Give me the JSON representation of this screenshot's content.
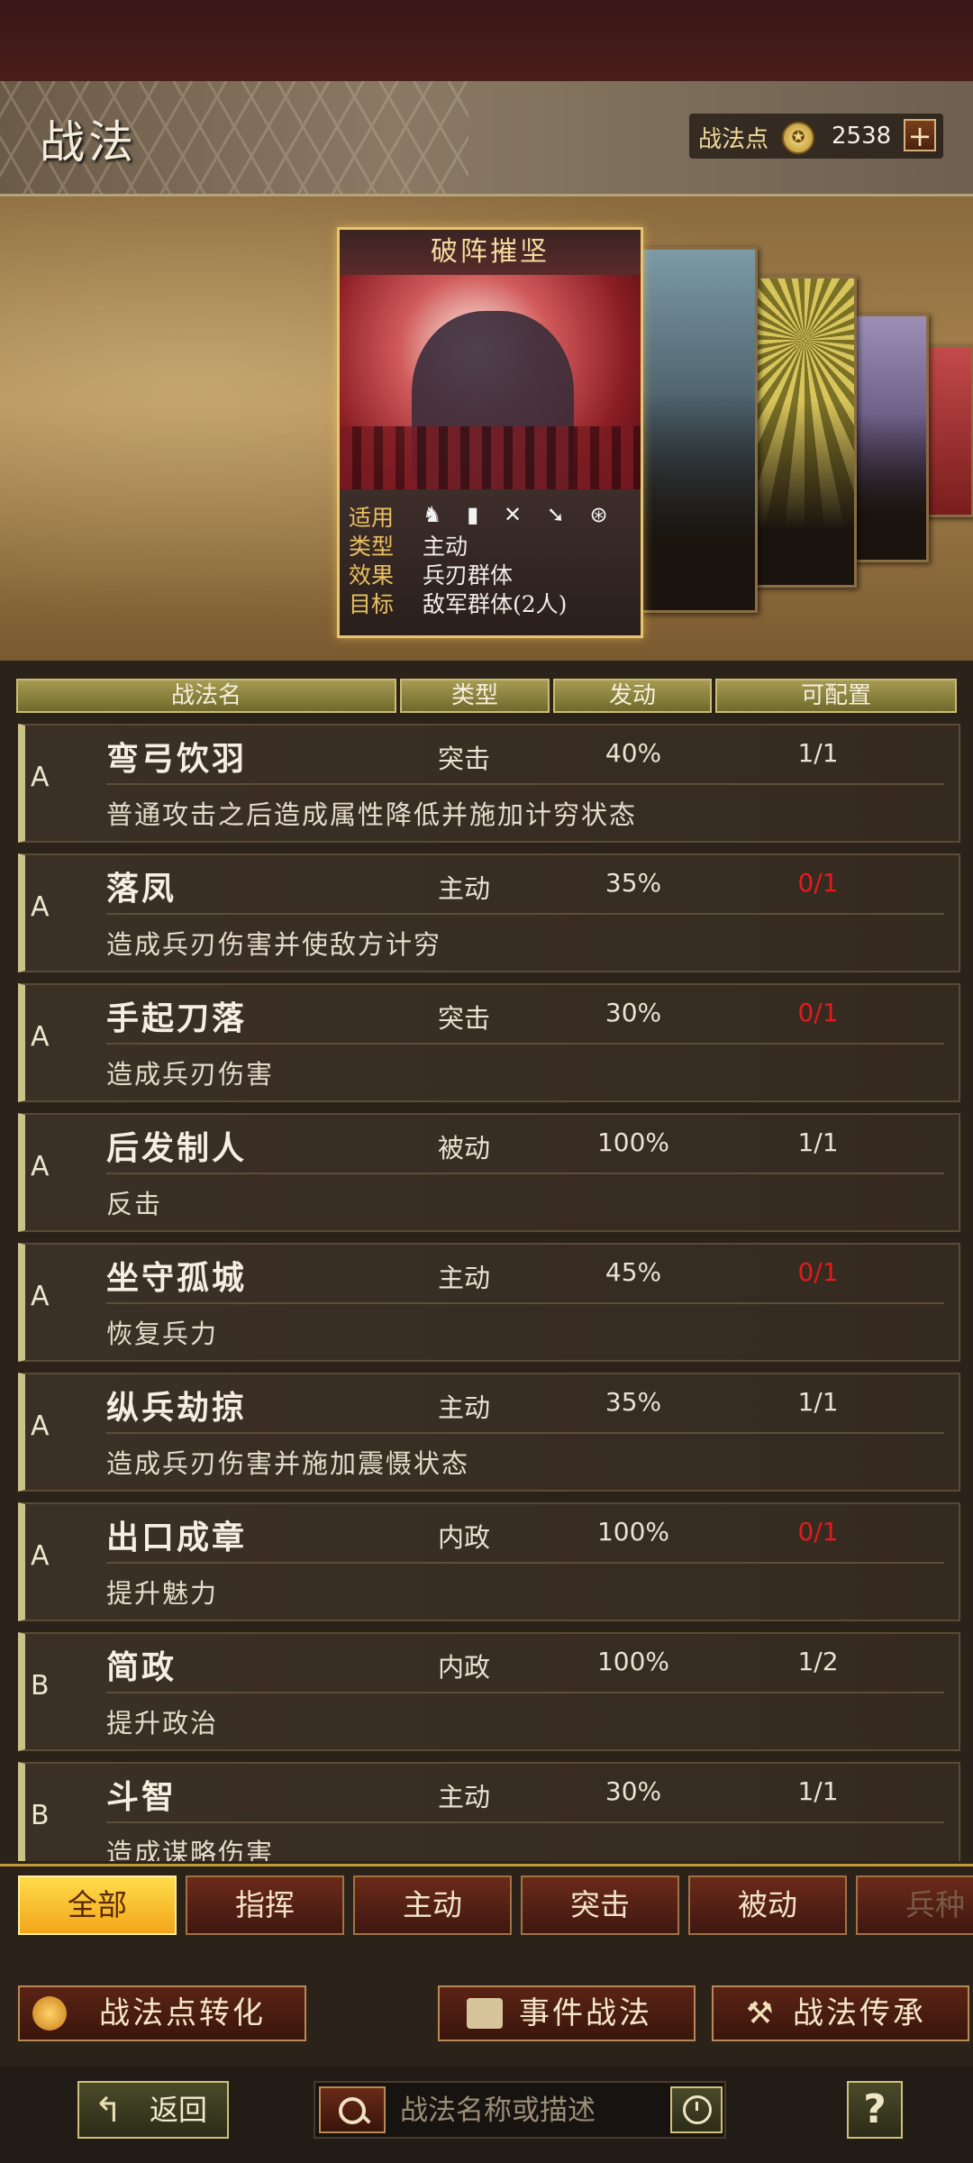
{
  "header": {
    "title": "战法",
    "points_label": "战法点",
    "points_value": "2538",
    "plus": "+",
    "coin_icon": "coin-icon"
  },
  "featured": {
    "name": "破阵摧坚",
    "apply_label": "适用",
    "apply_icons": "♞ ▮ ✕ ➘ ⊛",
    "type_label": "类型",
    "type_value": "主动",
    "effect_label": "效果",
    "effect_value": "兵刃群体",
    "target_label": "目标",
    "target_value": "敌军群体(2人)"
  },
  "table": {
    "headers": [
      "战法名",
      "类型",
      "发动",
      "可配置"
    ],
    "rows": [
      {
        "grade": "A",
        "name": "弯弓饮羽",
        "type": "突击",
        "rate": "40%",
        "count": "1/1",
        "count_red": false,
        "desc": "普通攻击之后造成属性降低并施加计穷状态"
      },
      {
        "grade": "A",
        "name": "落凤",
        "type": "主动",
        "rate": "35%",
        "count": "0/1",
        "count_red": true,
        "desc": "造成兵刃伤害并使敌方计穷"
      },
      {
        "grade": "A",
        "name": "手起刀落",
        "type": "突击",
        "rate": "30%",
        "count": "0/1",
        "count_red": true,
        "desc": "造成兵刃伤害"
      },
      {
        "grade": "A",
        "name": "后发制人",
        "type": "被动",
        "rate": "100%",
        "count": "1/1",
        "count_red": false,
        "desc": "反击"
      },
      {
        "grade": "A",
        "name": "坐守孤城",
        "type": "主动",
        "rate": "45%",
        "count": "0/1",
        "count_red": true,
        "desc": "恢复兵力"
      },
      {
        "grade": "A",
        "name": "纵兵劫掠",
        "type": "主动",
        "rate": "35%",
        "count": "1/1",
        "count_red": false,
        "desc": "造成兵刃伤害并施加震慑状态"
      },
      {
        "grade": "A",
        "name": "出口成章",
        "type": "内政",
        "rate": "100%",
        "count": "0/1",
        "count_red": true,
        "desc": "提升魅力"
      },
      {
        "grade": "B",
        "name": "简政",
        "type": "内政",
        "rate": "100%",
        "count": "1/2",
        "count_red": false,
        "desc": "提升政治"
      },
      {
        "grade": "B",
        "name": "斗智",
        "type": "主动",
        "rate": "30%",
        "count": "1/1",
        "count_red": false,
        "desc": "造成谋略伤害"
      }
    ]
  },
  "tabs": [
    "全部",
    "指挥",
    "主动",
    "突击",
    "被动",
    "兵种"
  ],
  "actions": {
    "convert": "战法点转化",
    "event": "事件战法",
    "inherit": "战法传承"
  },
  "bottom": {
    "back": "返回",
    "search_placeholder": "战法名称或描述",
    "help": "?"
  }
}
